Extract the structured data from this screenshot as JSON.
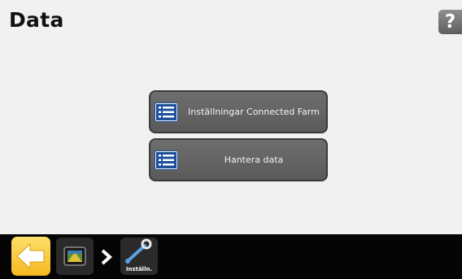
{
  "header": {
    "title": "Data",
    "help_label": "?"
  },
  "menu": {
    "items": [
      {
        "label": "Inställningar Connected Farm",
        "icon": "list-icon"
      },
      {
        "label": "Hantera data",
        "icon": "list-icon"
      }
    ]
  },
  "bottom_bar": {
    "back_icon": "back-arrow-icon",
    "breadcrumbs": [
      {
        "icon": "display-home-icon",
        "label": ""
      },
      {
        "icon": "wrench-icon",
        "label": "Inställn."
      }
    ]
  },
  "colors": {
    "background": "#f1f1f1",
    "button": "#646464",
    "bottom_bar": "#050505",
    "back_button": "#f7c435",
    "list_icon": "#1c4f9c"
  }
}
